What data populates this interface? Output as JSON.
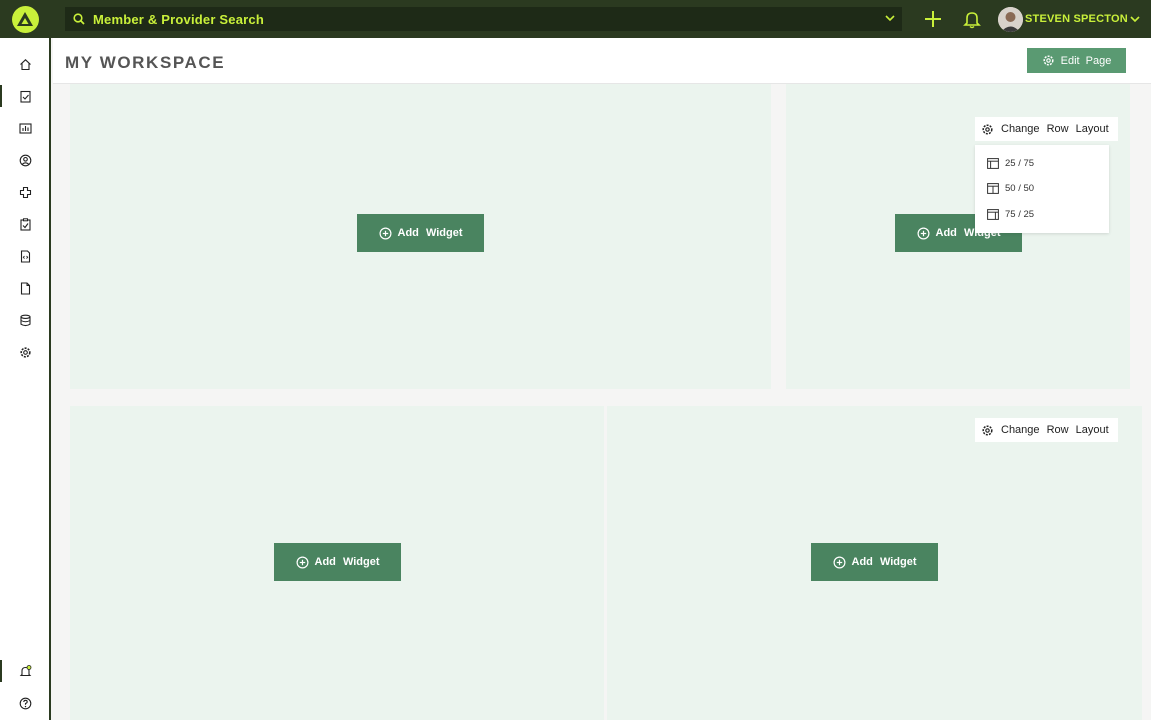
{
  "topbar": {
    "search_label": "Member & Provider Search",
    "user_name": "STEVEN SPECTON"
  },
  "header": {
    "title": "MY WORKSPACE",
    "edit_label": "Edit  Page"
  },
  "sidebar": {
    "items": [
      {
        "name": "home-icon"
      },
      {
        "name": "clipboard-check-icon"
      },
      {
        "name": "bar-chart-icon"
      },
      {
        "name": "user-circle-icon"
      },
      {
        "name": "medical-cross-icon"
      },
      {
        "name": "task-list-icon"
      },
      {
        "name": "document-code-icon"
      },
      {
        "name": "file-icon"
      },
      {
        "name": "database-icon"
      },
      {
        "name": "settings-icon"
      }
    ],
    "bottom": [
      {
        "name": "notification-settings-icon"
      },
      {
        "name": "help-icon"
      }
    ]
  },
  "widgets": {
    "add_label": "Add  Widget",
    "change_layout_label": "Change  Row  Layout",
    "layout_options": [
      "25 / 75",
      "50 / 50",
      "75 / 25"
    ]
  },
  "colors": {
    "topbar_bg": "#2b3a20",
    "accent_lime": "#c9f03a",
    "button_green": "#4a8460",
    "panel_bg": "#ebf4ee"
  }
}
